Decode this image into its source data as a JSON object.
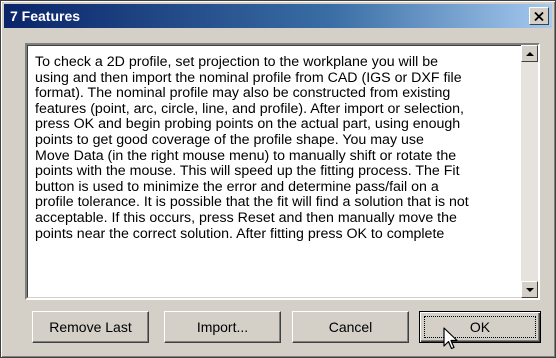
{
  "dialog": {
    "title": "7 Features",
    "close_icon": "close-icon"
  },
  "body": {
    "text": "To check a 2D profile, set projection to the workplane you will be\nusing and then import the nominal profile from CAD (IGS or DXF file\nformat).  The nominal profile may also be constructed from existing\nfeatures (point, arc, circle, line, and profile).  After import or selection,\npress OK and begin probing points on the actual part, using enough\npoints to get good coverage of the profile shape. You may use\nMove Data (in the right mouse menu) to manually shift or rotate the\npoints with the mouse.  This will speed up the fitting process.  The Fit\nbutton is used to minimize the error and determine pass/fail on a\nprofile tolerance.  It is possible that the fit will find a solution that is not\nacceptable.  If this occurs, press Reset and then manually move the\npoints near the correct solution. After fitting press OK to complete"
  },
  "buttons": {
    "remove_last": "Remove Last",
    "import": "Import...",
    "cancel": "Cancel",
    "ok": "OK"
  },
  "colors": {
    "title_start": "#0a246a",
    "title_end": "#a6caf0",
    "face": "#d4d0c8"
  }
}
